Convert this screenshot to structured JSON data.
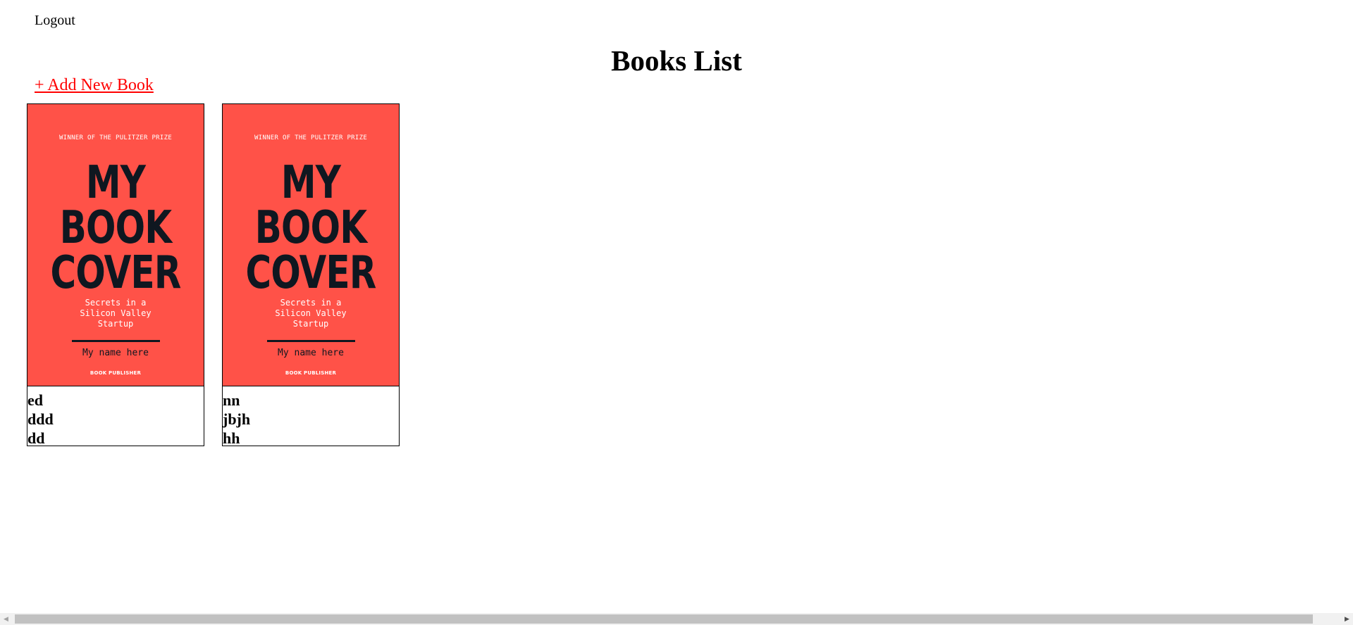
{
  "header": {
    "logout_label": "Logout",
    "title": "Books List",
    "add_label": "+ Add New Book"
  },
  "colors": {
    "link": "#ff0000",
    "cover_bg": "#ff5248",
    "cover_ink": "#0f1720"
  },
  "books": [
    {
      "cover": {
        "prize": "WINNER OF THE PULITZER PRIZE",
        "title_lines": [
          "MY",
          "BOOK",
          "COVER"
        ],
        "subtitle": "Secrets in a\nSilicon Valley\nStartup",
        "author": "My name here",
        "publisher": "BOOK PUBLISHER"
      },
      "lines": [
        "ed",
        "ddd",
        "dd"
      ]
    },
    {
      "cover": {
        "prize": "WINNER OF THE PULITZER PRIZE",
        "title_lines": [
          "MY",
          "BOOK",
          "COVER"
        ],
        "subtitle": "Secrets in a\nSilicon Valley\nStartup",
        "author": "My name here",
        "publisher": "BOOK PUBLISHER"
      },
      "lines": [
        "nn",
        "jbjh",
        "hh"
      ]
    }
  ],
  "scrollbar": {
    "left_icon": "triangle-left-icon",
    "right_icon": "triangle-right-icon"
  }
}
